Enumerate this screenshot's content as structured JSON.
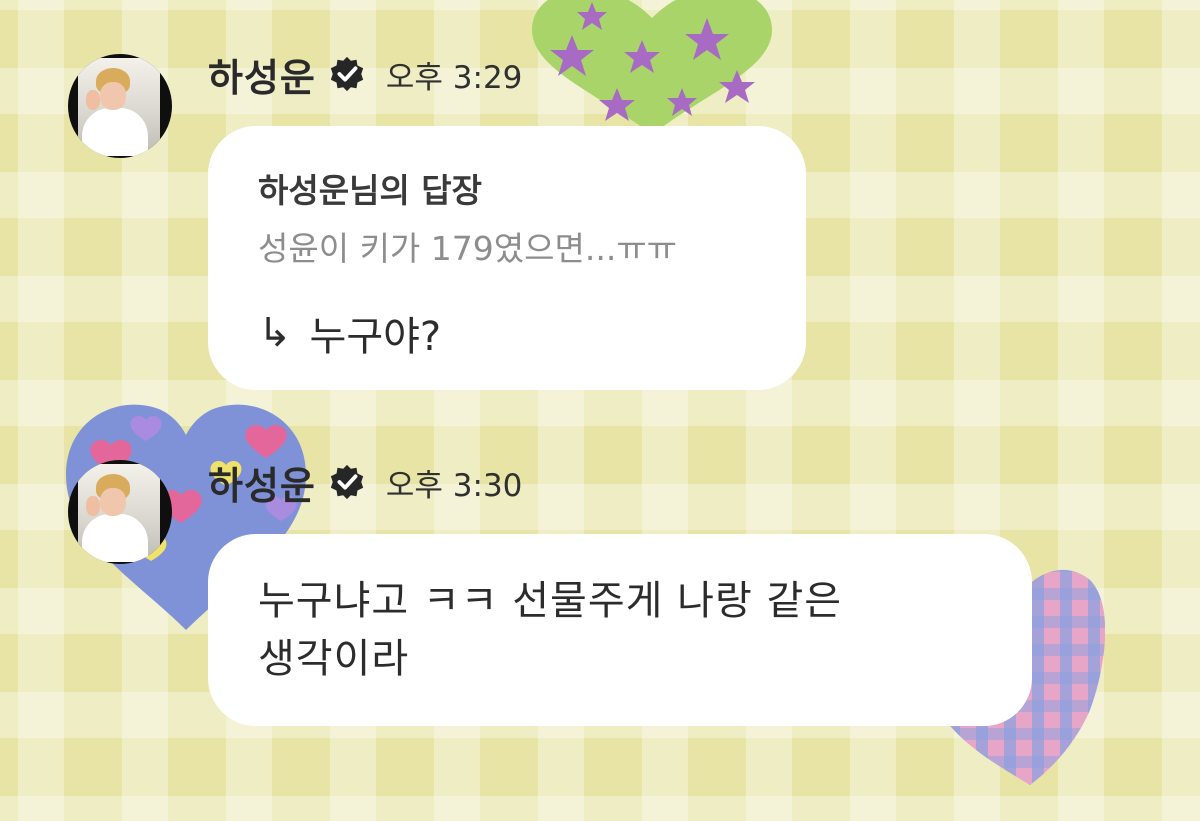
{
  "chat": {
    "messages": [
      {
        "sender": "하성운",
        "verified_icon": "verified-badge-icon",
        "time": "오후 3:29",
        "reply": {
          "title": "하성운님의 답장",
          "quoted_text": "성윤이 키가 179였으면...ㅠㅠ",
          "arrow_icon": "↳",
          "text": "누구야?"
        }
      },
      {
        "sender": "하성운",
        "verified_icon": "verified-badge-icon",
        "time": "오후 3:30",
        "text": "누구냐고 ㅋㅋ 선물주게 나랑 같은\n생각이라"
      }
    ]
  },
  "colors": {
    "background": "#e7e4a6",
    "bubble": "#ffffff",
    "text": "#2c2c2c",
    "quote_text": "#8d8d8d"
  }
}
